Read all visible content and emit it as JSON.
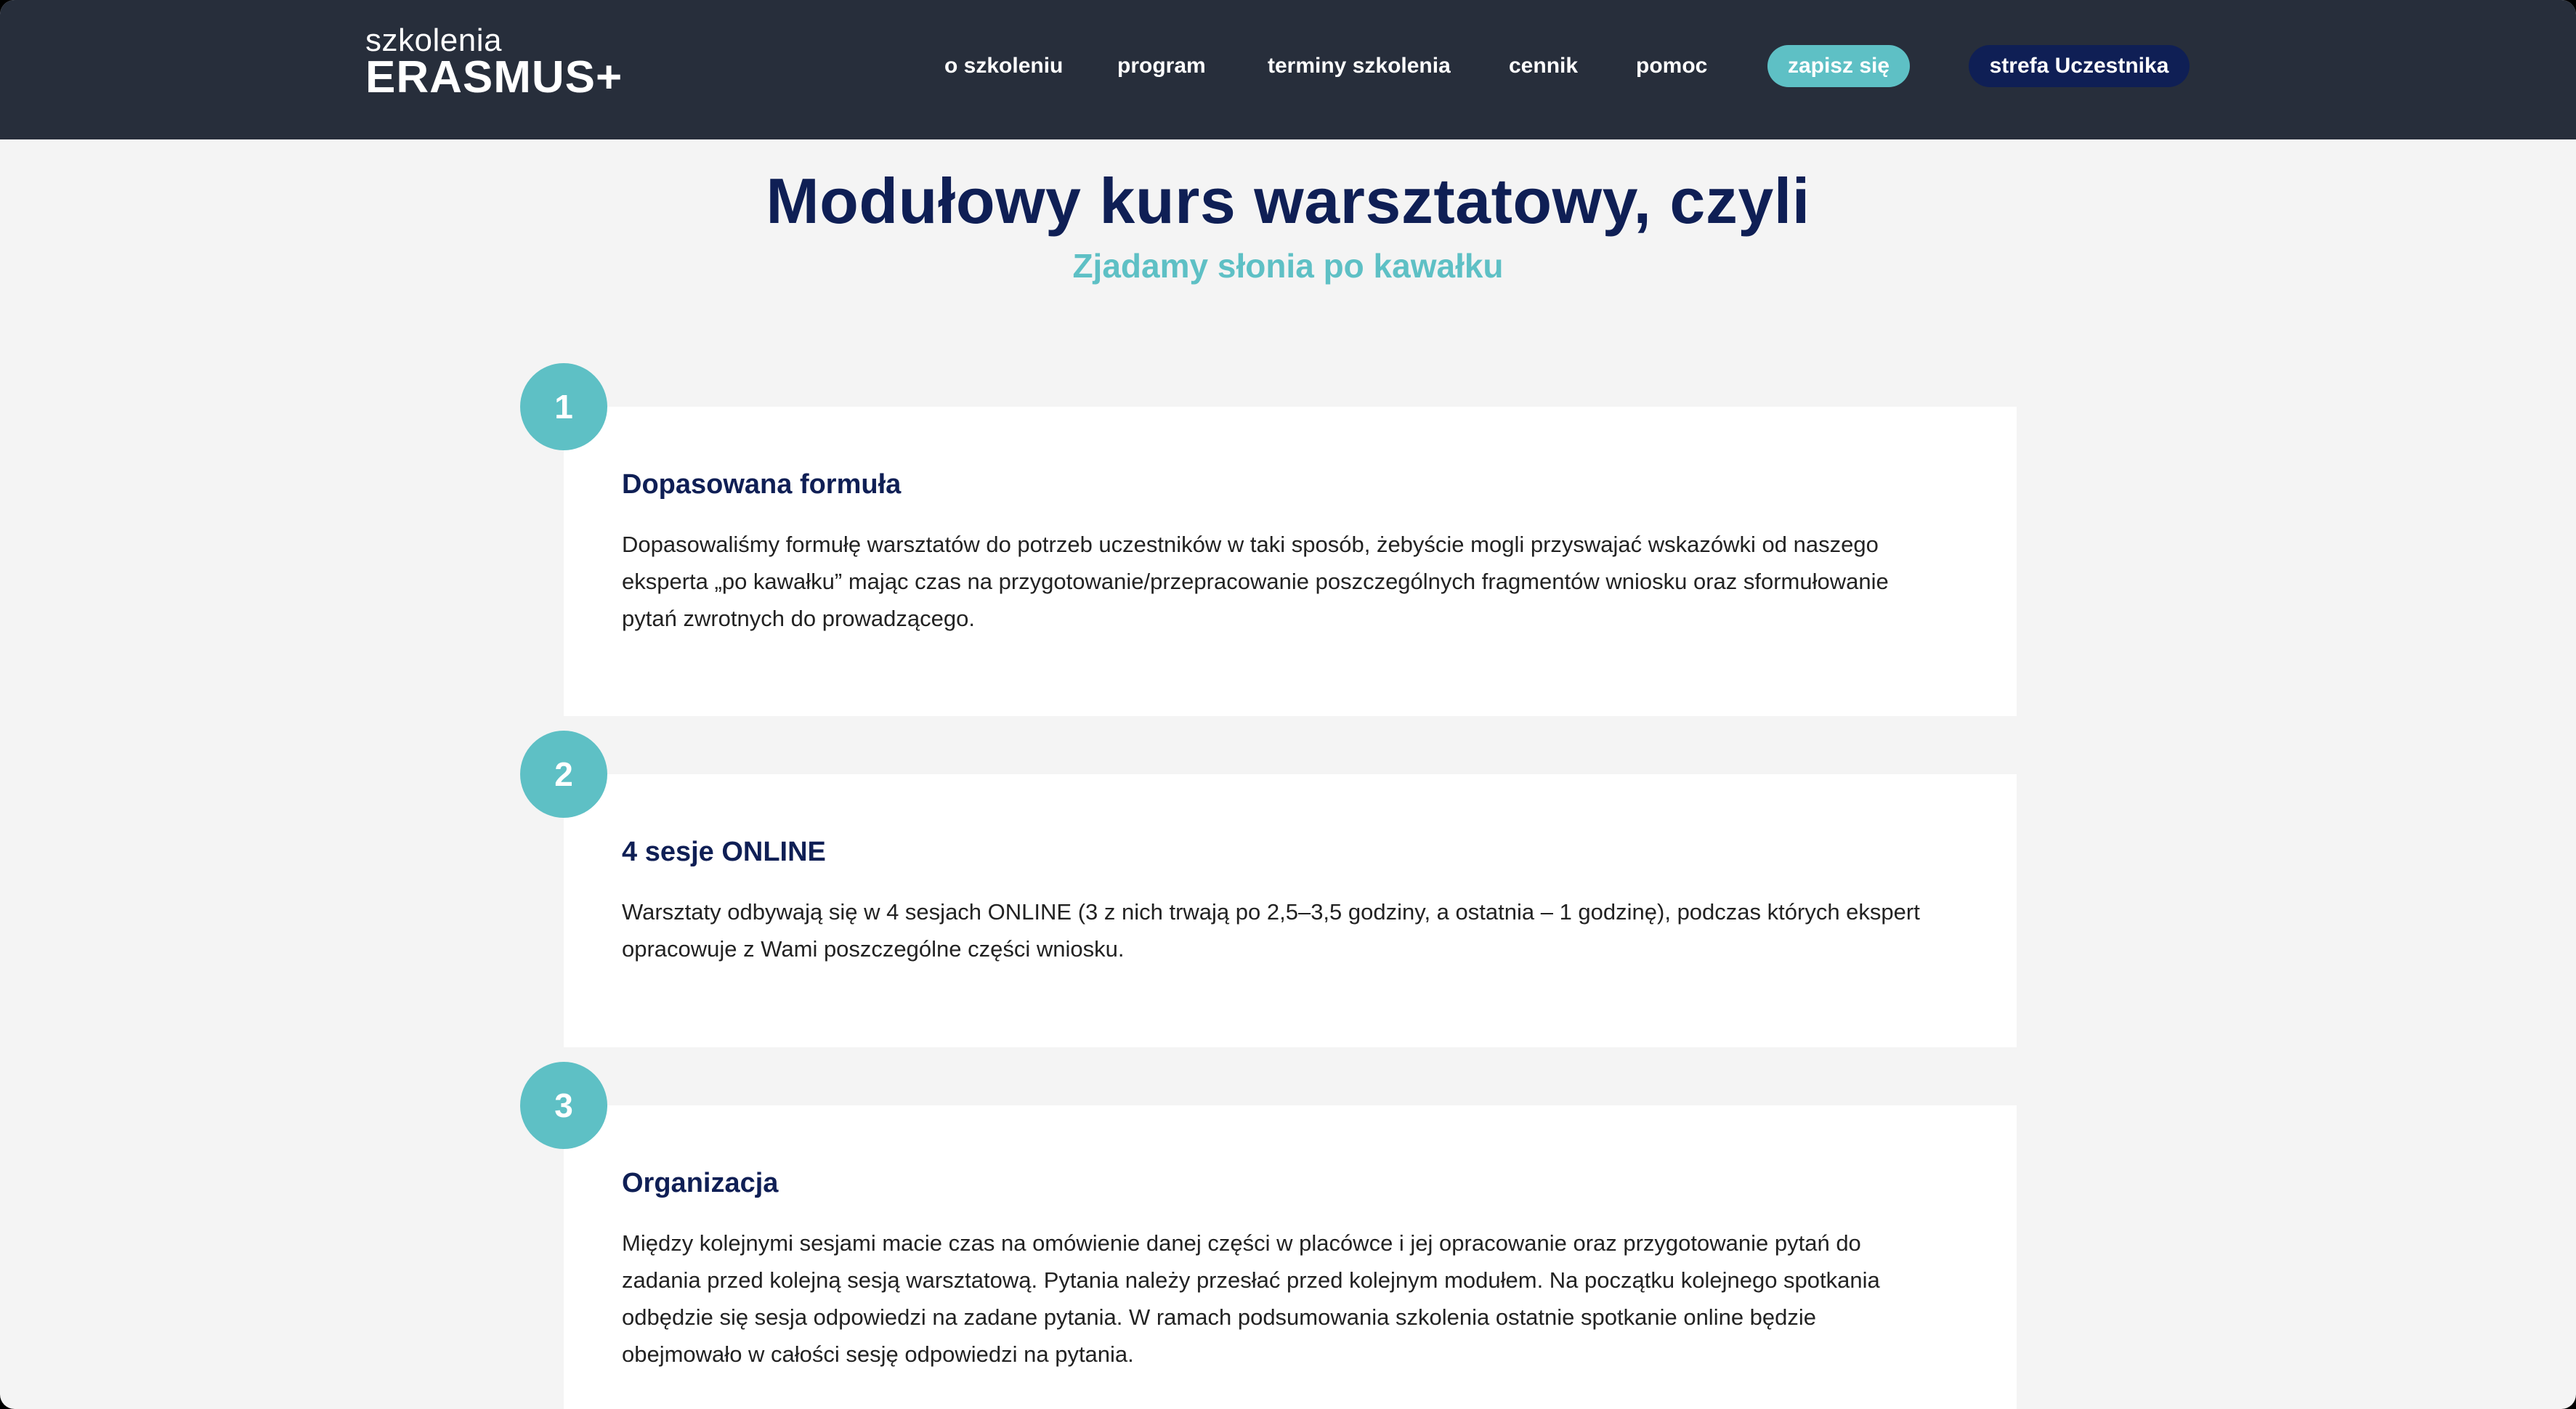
{
  "logo": {
    "small": "szkolenia",
    "big": "ERASMUS+"
  },
  "nav": {
    "items": [
      "o szkoleniu",
      "program",
      "terminy szkolenia",
      "cennik",
      "pomoc"
    ],
    "signup_label": "zapisz się",
    "zone_label": "strefa Uczestnika"
  },
  "hero": {
    "title": "Modułowy kurs warsztatowy, czyli",
    "subtitle": "Zjadamy słonia po kawałku"
  },
  "cards": [
    {
      "number": "1",
      "title": "Dopasowana formuła",
      "lines": [
        "Dopasowaliśmy formułę warsztatów do potrzeb uczestników w taki sposób, żebyście mogli przyswajać wskazówki od naszego",
        "eksperta „po kawałku” mając czas na przygotowanie/przepracowanie poszczególnych fragmentów wniosku oraz sformułowanie",
        "pytań zwrotnych do prowadzącego."
      ]
    },
    {
      "number": "2",
      "title": "4 sesje ONLINE",
      "lines": [
        "Warsztaty odbywają się w 4 sesjach ONLINE (3 z nich trwają po 2,5–3,5 godziny, a ostatnia – 1 godzinę), podczas których ekspert",
        "opracowuje z Wami poszczególne części wniosku."
      ]
    },
    {
      "number": "3",
      "title": "Organizacja",
      "lines": [
        "Między kolejnymi sesjami macie czas na omówienie danej części w placówce i jej opracowanie oraz przygotowanie pytań do",
        "zadania przed kolejną sesją warsztatową. Pytania należy przesłać przed kolejnym modułem. Na początku kolejnego spotkania",
        "odbędzie się sesja odpowiedzi na zadane pytania. W ramach podsumowania szkolenia ostatnie spotkanie online będzie",
        "obejmowało w całości sesję odpowiedzi na pytania."
      ]
    }
  ],
  "colors": {
    "header_bg": "#272e3b",
    "navy": "#0f1f55",
    "teal": "#5ec0c5",
    "page_bg": "#f4f4f4"
  }
}
